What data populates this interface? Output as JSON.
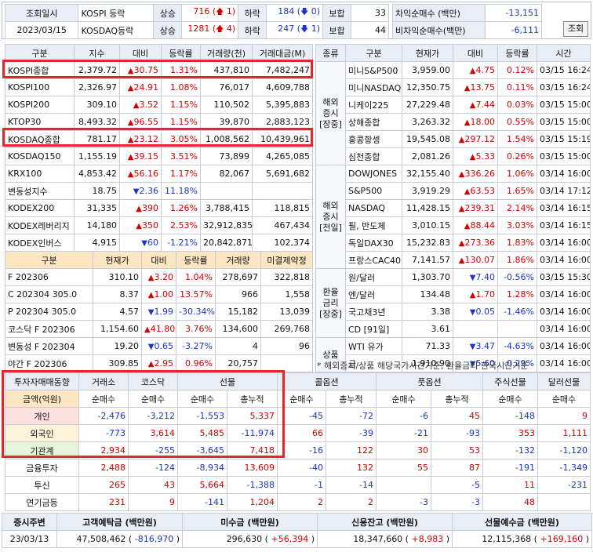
{
  "top": {
    "label_time": "조회일시",
    "date": "2023/03/15",
    "rows": [
      {
        "index": "KOSPI 등락",
        "up_label": "상승",
        "up": "716",
        "up_chg": "1",
        "down_label": "하락",
        "down": "184",
        "down_chg": "0",
        "flat_label": "보합",
        "flat": "33",
        "net_label": "차익순매수 (백만)",
        "net": "-13,151"
      },
      {
        "index": "KOSDAQ등락",
        "up_label": "상승",
        "up": "1281",
        "up_chg": "4",
        "down_label": "하락",
        "down": "247",
        "down_chg": "1",
        "flat_label": "보합",
        "flat": "44",
        "net_label": "비차익순매수(백만)",
        "net": "-6,111"
      }
    ],
    "query_button": "조회"
  },
  "index_table": {
    "headers": [
      "구분",
      "지수",
      "대비",
      "등락률",
      "거래량(천)",
      "거래대금(M)"
    ],
    "rows": [
      {
        "name": "KOSPI종합",
        "val": "2,379.72",
        "dir": "up",
        "chg": "30.75",
        "pct": "1.31%",
        "vol": "437,810",
        "amt": "7,482,247"
      },
      {
        "name": "KOSPI100",
        "val": "2,326.97",
        "dir": "up",
        "chg": "24.91",
        "pct": "1.08%",
        "vol": "76,017",
        "amt": "4,609,788"
      },
      {
        "name": "KOSPI200",
        "val": "309.10",
        "dir": "up",
        "chg": "3.52",
        "pct": "1.15%",
        "vol": "110,502",
        "amt": "5,395,883"
      },
      {
        "name": "KTOP30",
        "val": "8,493.32",
        "dir": "up",
        "chg": "96.55",
        "pct": "1.15%",
        "vol": "39,870",
        "amt": "2,883,123"
      },
      {
        "name": "KOSDAQ종합",
        "val": "781.17",
        "dir": "up",
        "chg": "23.12",
        "pct": "3.05%",
        "vol": "1,008,562",
        "amt": "10,439,961"
      },
      {
        "name": "KOSDAQ150",
        "val": "1,155.19",
        "dir": "up",
        "chg": "39.15",
        "pct": "3.51%",
        "vol": "73,899",
        "amt": "4,265,085"
      },
      {
        "name": "KRX100",
        "val": "4,853.42",
        "dir": "up",
        "chg": "56.16",
        "pct": "1.17%",
        "vol": "82,067",
        "amt": "5,691,682"
      },
      {
        "name": "변동성지수",
        "val": "18.75",
        "dir": "dn",
        "chg": "2.36",
        "pct": "11.18%",
        "vol": "",
        "amt": ""
      },
      {
        "name": "KODEX200",
        "val": "31,335",
        "dir": "up",
        "chg": "390",
        "pct": "1.26%",
        "vol": "3,788,415",
        "amt": "118,815"
      },
      {
        "name": "KODEX레버리지",
        "val": "14,180",
        "dir": "up",
        "chg": "350",
        "pct": "2.53%",
        "vol": "32,912,835",
        "amt": "467,434"
      },
      {
        "name": "KODEX인버스",
        "val": "4,915",
        "dir": "dn",
        "chg": "60",
        "pct": "-1.21%",
        "vol": "20,842,871",
        "amt": "102,374"
      }
    ]
  },
  "futures_table": {
    "headers": [
      "구분",
      "현재가",
      "대비",
      "등락률",
      "거래량",
      "미결제약정"
    ],
    "rows": [
      {
        "name": "F 202306",
        "val": "310.10",
        "dir": "up",
        "chg": "3.20",
        "pct": "1.04%",
        "vol": "278,697",
        "oi": "322,818"
      },
      {
        "name": "C 202304 305.0",
        "val": "8.37",
        "dir": "up",
        "chg": "1.00",
        "pct": "13.57%",
        "vol": "966",
        "oi": "1,558"
      },
      {
        "name": "P 202304 305.0",
        "val": "4.57",
        "dir": "dn",
        "chg": "1.99",
        "pct": "-30.34%",
        "vol": "15,182",
        "oi": "13,039"
      },
      {
        "name": "코스닥 F 202306",
        "val": "1,154.60",
        "dir": "up",
        "chg": "41.80",
        "pct": "3.76%",
        "vol": "134,600",
        "oi": "269,768"
      },
      {
        "name": "변동성 F 202304",
        "val": "19.20",
        "dir": "dn",
        "chg": "0.65",
        "pct": "-3.27%",
        "vol": "4",
        "oi": "96"
      },
      {
        "name": "야간 F 202306",
        "val": "309.85",
        "dir": "up",
        "chg": "2.95",
        "pct": "0.96%",
        "vol": "20,757",
        "oi": ""
      }
    ]
  },
  "world_table": {
    "headers": [
      "종류",
      "구분",
      "현재가",
      "대비",
      "등락률",
      "시간"
    ],
    "groups": [
      {
        "label": "해외\n증시\n[장중]",
        "rows": [
          {
            "name": "미니S&P500",
            "val": "3,959.00",
            "dir": "up",
            "chg": "4.75",
            "pct": "0.12%",
            "time": "03/15 16:24"
          },
          {
            "name": "미니NASDAQ",
            "val": "12,350.75",
            "dir": "up",
            "chg": "13.75",
            "pct": "0.11%",
            "time": "03/15 16:24"
          },
          {
            "name": "니케이225",
            "val": "27,229.48",
            "dir": "up",
            "chg": "7.44",
            "pct": "0.03%",
            "time": "03/15 15:00"
          },
          {
            "name": "상해종합",
            "val": "3,263.32",
            "dir": "up",
            "chg": "18.00",
            "pct": "0.55%",
            "time": "03/15 15:00"
          },
          {
            "name": "홍콩항셍",
            "val": "19,545.08",
            "dir": "up",
            "chg": "297.12",
            "pct": "1.54%",
            "time": "03/15 15:19"
          },
          {
            "name": "심천종합",
            "val": "2,081.26",
            "dir": "up",
            "chg": "5.33",
            "pct": "0.26%",
            "time": "03/15 15:00"
          }
        ]
      },
      {
        "label": "해외\n증시\n[전일]",
        "rows": [
          {
            "name": "DOWJONES",
            "val": "32,155.40",
            "dir": "up",
            "chg": "336.26",
            "pct": "1.06%",
            "time": "03/14 16:00"
          },
          {
            "name": "S&P500",
            "val": "3,919.29",
            "dir": "up",
            "chg": "63.53",
            "pct": "1.65%",
            "time": "03/14 17:12"
          },
          {
            "name": "NASDAQ",
            "val": "11,428.15",
            "dir": "up",
            "chg": "239.31",
            "pct": "2.14%",
            "time": "03/14 16:15"
          },
          {
            "name": "필, 반도체",
            "val": "3,010.15",
            "dir": "up",
            "chg": "88.44",
            "pct": "3.03%",
            "time": "03/14 16:15"
          },
          {
            "name": "독일DAX30",
            "val": "15,232.83",
            "dir": "up",
            "chg": "273.36",
            "pct": "1.83%",
            "time": "03/14 16:00"
          },
          {
            "name": "프랑스CAC40",
            "val": "7,141.57",
            "dir": "up",
            "chg": "130.07",
            "pct": "1.86%",
            "time": "03/14 16:00"
          }
        ]
      },
      {
        "label": "환율\n금리\n[장중]",
        "rows": [
          {
            "name": "원/달러",
            "val": "1,303.70",
            "dir": "dn",
            "chg": "7.40",
            "pct": "-0.56%",
            "time": "03/15 15:30"
          },
          {
            "name": "엔/달러",
            "val": "134.48",
            "dir": "up",
            "chg": "1.70",
            "pct": "1.28%",
            "time": "03/14 16:00"
          },
          {
            "name": "국고채3년",
            "val": "3.38",
            "dir": "dn",
            "chg": "0.05",
            "pct": "-1.46%",
            "time": "03/14 16:00"
          },
          {
            "name": "CD [91일]",
            "val": "3.61",
            "dir": "",
            "chg": "",
            "pct": "",
            "time": "03/14 16:00"
          }
        ]
      },
      {
        "label": "상품",
        "rows": [
          {
            "name": "WTI 유가",
            "val": "71.33",
            "dir": "dn",
            "chg": "3.47",
            "pct": "-4.63%",
            "time": "03/14 16:00"
          },
          {
            "name": "금",
            "val": "1,910.90",
            "dir": "dn",
            "chg": "5.60",
            "pct": "-0.29%",
            "time": "03/14 16:00"
          }
        ]
      }
    ],
    "note": "* 해외증시/상품 해당국가시간기준, 환율금리 한국시간기준"
  },
  "investor_table": {
    "head1": [
      "투자자매매동향",
      "거래소",
      "코스닥",
      "선물",
      "콜옵션",
      "풋옵션",
      "주식선물",
      "달러선물"
    ],
    "head2": [
      "금액(억원)",
      "순매수",
      "순매수",
      "순매수",
      "총누적",
      "순매수",
      "총누적",
      "순매수",
      "총누적",
      "순매수",
      "순매수"
    ],
    "rows": [
      {
        "name": "개인",
        "vals": [
          "-2,476",
          "-3,212",
          "-1,553",
          "5,337",
          "-45",
          "-72",
          "-6",
          "45",
          "-148",
          "9"
        ]
      },
      {
        "name": "외국인",
        "vals": [
          "-773",
          "3,614",
          "5,485",
          "-11,974",
          "66",
          "-39",
          "-21",
          "-93",
          "353",
          "1,111"
        ]
      },
      {
        "name": "기관계",
        "vals": [
          "2,934",
          "-255",
          "-3,645",
          "7,418",
          "-16",
          "122",
          "30",
          "53",
          "-132",
          "-1,120"
        ]
      },
      {
        "name": "금융투자",
        "vals": [
          "2,488",
          "-124",
          "-8,934",
          "13,609",
          "-40",
          "132",
          "55",
          "87",
          "-191",
          "-1,349"
        ]
      },
      {
        "name": "투신",
        "vals": [
          "265",
          "43",
          "5,664",
          "-1,388",
          "-1",
          "-14",
          "",
          "-5",
          "11",
          "-231"
        ]
      },
      {
        "name": "연기금등",
        "vals": [
          "231",
          "9",
          "-141",
          "1,204",
          "2",
          "2",
          "-3",
          "-3",
          "48",
          ""
        ]
      }
    ]
  },
  "bottom": {
    "headers": [
      "증시주변",
      "고객예탁금 (백만원)",
      "미수금 (백만원)",
      "신용잔고 (백만원)",
      "선물예수금 (백만원)"
    ],
    "date": "23/03/13",
    "deposit": "47,508,462",
    "deposit_chg": "-816,970",
    "unpaid": "296,630",
    "unpaid_chg": "+56,394",
    "credit": "18,347,660",
    "credit_chg": "+8,983",
    "futures_dep": "12,115,368",
    "futures_dep_chg": "+169,160"
  }
}
